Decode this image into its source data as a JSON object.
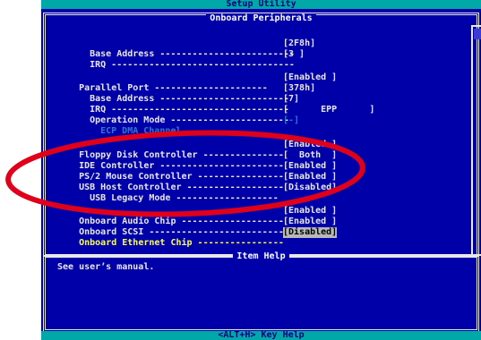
{
  "title": "Setup Utility",
  "section_title": "Onboard Peripherals",
  "rows": [
    {
      "label": "Base Address -------------------------",
      "value": "[2F8h]"
    },
    {
      "label": "IRQ ----------------------------------",
      "value": "[3 ]"
    },
    {
      "label": "Parallel Port ---------------------",
      "value": "[Enabled ]"
    },
    {
      "label": "Base Address ------------------------",
      "value": "[378h]"
    },
    {
      "label": "IRQ ---------------------------------",
      "value": "[7]"
    },
    {
      "label": "Operation Mode ----------------------",
      "value": "[      EPP      ]"
    },
    {
      "label": "ECP DMA Channel",
      "value": "[-]"
    },
    {
      "label": "Floppy Disk Controller ---------------",
      "value": "[Enabled ]"
    },
    {
      "label": "IDE Controller -----------------------",
      "value": "[  Both  ]"
    },
    {
      "label": "PS/2 Mouse Controller ----------------",
      "value": "[Enabled ]"
    },
    {
      "label": "USB Host Controller ------------------",
      "value": "[Enabled ]"
    },
    {
      "label": "USB Legacy Mode -------------------",
      "value": "[Disabled]"
    },
    {
      "label": "Onboard Audio Chip -------------------",
      "value": "[Enabled ]"
    },
    {
      "label": "Onboard SCSI -------------------------",
      "value": "[Enabled ]"
    },
    {
      "label": "Onboard Ethernet Chip ----------------",
      "value": "[Disabled]"
    }
  ],
  "help_title": "Item Help",
  "help_text": "See user’s manual.",
  "footer": "<ALT+H>  Key Help",
  "colors": {
    "background": "#0000a8",
    "bar": "#00a8a8",
    "highlight_text": "#ffff54",
    "annotation": "#e0001a"
  }
}
